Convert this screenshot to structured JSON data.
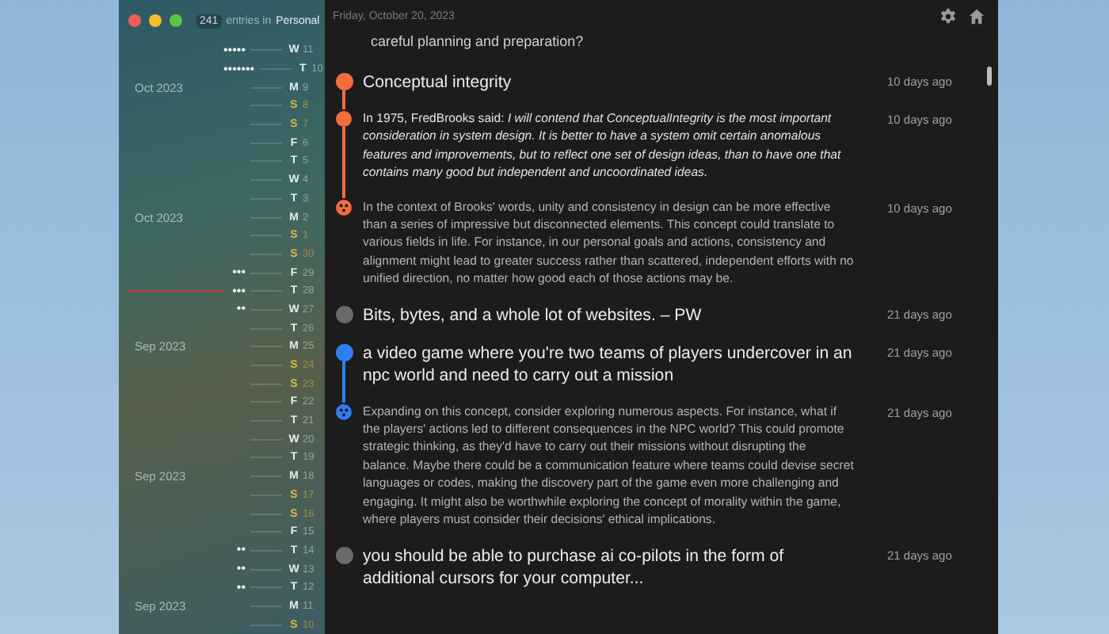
{
  "window": {
    "entry_count": "241",
    "entries_label": "entries in",
    "journal": "Personal"
  },
  "sidebar": {
    "days": [
      {
        "weekday": "W",
        "day": "11",
        "weekend": false,
        "dots": "•••••",
        "marked": false
      },
      {
        "weekday": "T",
        "day": "10",
        "weekend": false,
        "dots": "•••••••",
        "marked": false
      },
      {
        "weekday": "M",
        "day": "9",
        "weekend": false,
        "month": "Oct 2023",
        "marked": false
      },
      {
        "weekday": "S",
        "day": "8",
        "weekend": true,
        "marked": false
      },
      {
        "weekday": "S",
        "day": "7",
        "weekend": true,
        "marked": false
      },
      {
        "weekday": "F",
        "day": "6",
        "weekend": false,
        "marked": false
      },
      {
        "weekday": "T",
        "day": "5",
        "weekend": false,
        "marked": false
      },
      {
        "weekday": "W",
        "day": "4",
        "weekend": false,
        "marked": false
      },
      {
        "weekday": "T",
        "day": "3",
        "weekend": false,
        "marked": false
      },
      {
        "weekday": "M",
        "day": "2",
        "weekend": false,
        "month": "Oct 2023",
        "marked": false
      },
      {
        "weekday": "S",
        "day": "1",
        "weekend": true,
        "marked": false
      },
      {
        "weekday": "S",
        "day": "30",
        "weekend": true,
        "marked": false
      },
      {
        "weekday": "F",
        "day": "29",
        "weekend": false,
        "dots": "•••",
        "marked": false
      },
      {
        "weekday": "T",
        "day": "28",
        "weekend": false,
        "dots": "•••",
        "marked": true
      },
      {
        "weekday": "W",
        "day": "27",
        "weekend": false,
        "dots": "••",
        "marked": false
      },
      {
        "weekday": "T",
        "day": "26",
        "weekend": false,
        "marked": false
      },
      {
        "weekday": "M",
        "day": "25",
        "weekend": false,
        "month": "Sep 2023",
        "marked": false
      },
      {
        "weekday": "S",
        "day": "24",
        "weekend": true,
        "marked": false
      },
      {
        "weekday": "S",
        "day": "23",
        "weekend": true,
        "marked": false
      },
      {
        "weekday": "F",
        "day": "22",
        "weekend": false,
        "marked": false
      },
      {
        "weekday": "T",
        "day": "21",
        "weekend": false,
        "marked": false
      },
      {
        "weekday": "W",
        "day": "20",
        "weekend": false,
        "marked": false
      },
      {
        "weekday": "T",
        "day": "19",
        "weekend": false,
        "marked": false
      },
      {
        "weekday": "M",
        "day": "18",
        "weekend": false,
        "month": "Sep 2023",
        "marked": false
      },
      {
        "weekday": "S",
        "day": "17",
        "weekend": true,
        "marked": false
      },
      {
        "weekday": "S",
        "day": "16",
        "weekend": true,
        "marked": false
      },
      {
        "weekday": "F",
        "day": "15",
        "weekend": false,
        "marked": false
      },
      {
        "weekday": "T",
        "day": "14",
        "weekend": false,
        "dots": "••",
        "marked": false
      },
      {
        "weekday": "W",
        "day": "13",
        "weekend": false,
        "dots": "••",
        "marked": false
      },
      {
        "weekday": "T",
        "day": "12",
        "weekend": false,
        "dots": "••",
        "marked": false
      },
      {
        "weekday": "M",
        "day": "11",
        "weekend": false,
        "month": "Sep 2023",
        "marked": false
      },
      {
        "weekday": "S",
        "day": "10",
        "weekend": true,
        "marked": false
      }
    ]
  },
  "main": {
    "date": "Friday, October 20, 2023",
    "lead_text": "careful planning and preparation?",
    "entries": [
      {
        "title": "Conceptual integrity",
        "time": "10 days ago",
        "color": "#f26d3d",
        "replies": [
          {
            "kind": "note",
            "text": "In 1975, FredBrooks said: *I will contend that ConceptualIntegrity is the most important consideration in system design. It is better to have a system omit certain anomalous features and improvements, but to reflect one set of design ideas, than to have one that contains many good but independent and uncoordinated ideas.*",
            "time": "10 days ago"
          },
          {
            "kind": "ai",
            "text": "In the context of Brooks' words, unity and consistency in design can be more effective than a series of impressive but disconnected elements. This concept could translate to various fields in life. For instance, in our personal goals and actions, consistency and alignment might lead to greater success rather than scattered, independent efforts with no unified direction, no matter how good each of those actions may be.",
            "time": "10 days ago"
          }
        ]
      },
      {
        "title": "Bits, bytes, and a whole lot of websites. – PW",
        "time": "21 days ago",
        "color": "#6a6a6a"
      },
      {
        "title": "a video game where you're two teams of players undercover in an npc world and need to carry out a mission",
        "time": "21 days ago",
        "color": "#2f7ef0",
        "replies": [
          {
            "kind": "ai",
            "text": "Expanding on this concept, consider exploring numerous aspects. For instance, what if the players' actions led to different consequences in the NPC world? This could promote strategic thinking, as they'd have to carry out their missions without disrupting the balance. Maybe there could be a communication feature where teams could devise secret languages or codes, making the discovery part of the game even more challenging and engaging. It might also be worthwhile exploring the concept of morality within the game, where players must consider their decisions' ethical implications.",
            "time": "21 days ago"
          }
        ]
      },
      {
        "title": "you should be able to purchase ai co-pilots in the form of additional cursors for your computer...",
        "time": "21 days ago",
        "color": "#6a6a6a"
      }
    ]
  }
}
